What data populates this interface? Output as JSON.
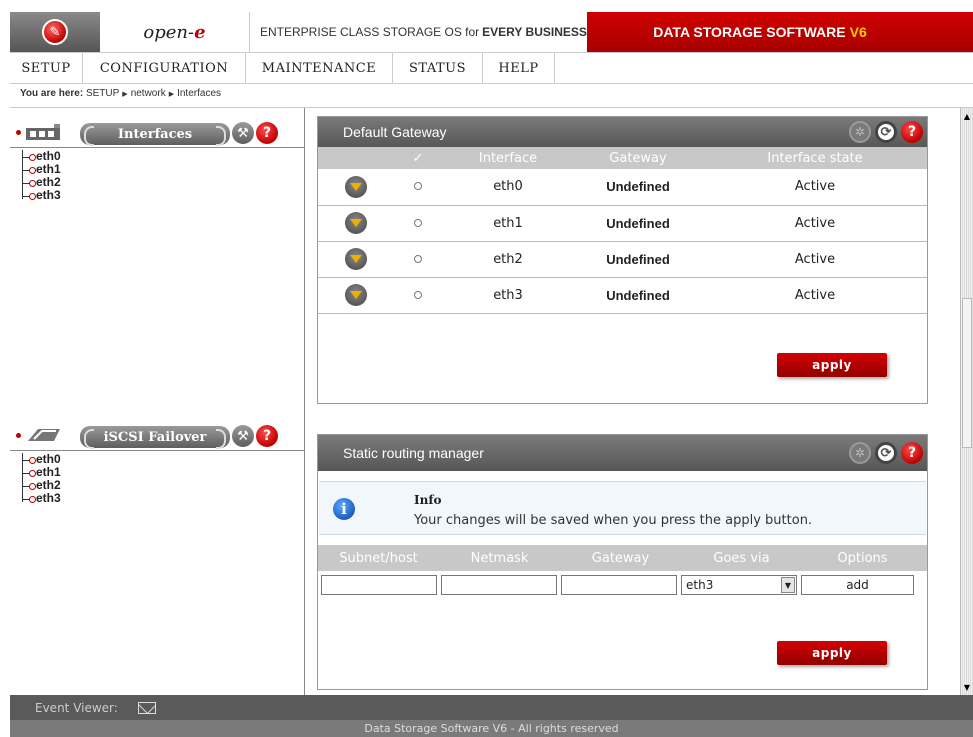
{
  "header": {
    "brand_prefix": "open-",
    "brand_suffix": "e",
    "slogan_prefix": "ENTERPRISE CLASS STORAGE OS for",
    "slogan_bold": "EVERY BUSINESS",
    "product_name": "DATA STORAGE SOFTWARE",
    "product_version": "V6",
    "brand_color": "#c00000",
    "version_color": "#ffcc00"
  },
  "menu": [
    "SETUP",
    "CONFIGURATION",
    "MAINTENANCE",
    "STATUS",
    "HELP"
  ],
  "breadcrumb": {
    "label": "You are here:",
    "items": [
      "SETUP",
      "network",
      "Interfaces"
    ]
  },
  "left": {
    "interfaces": {
      "title": "Interfaces",
      "items": [
        "eth0",
        "eth1",
        "eth2",
        "eth3"
      ]
    },
    "failover": {
      "title": "iSCSI Failover",
      "items": [
        "eth0",
        "eth1",
        "eth2",
        "eth3"
      ]
    }
  },
  "default_gateway": {
    "title": "Default Gateway",
    "columns": [
      "✓",
      "Interface",
      "Gateway",
      "Interface state"
    ],
    "rows": [
      {
        "interface": "eth0",
        "gateway": "Undefined",
        "state": "Active"
      },
      {
        "interface": "eth1",
        "gateway": "Undefined",
        "state": "Active"
      },
      {
        "interface": "eth2",
        "gateway": "Undefined",
        "state": "Active"
      },
      {
        "interface": "eth3",
        "gateway": "Undefined",
        "state": "Active"
      }
    ],
    "apply_label": "apply"
  },
  "static_routing": {
    "title": "Static routing manager",
    "info_title": "Info",
    "info_text": "Your changes will be saved when you press the apply button.",
    "columns": [
      "Subnet/host",
      "Netmask",
      "Gateway",
      "Goes via",
      "Options"
    ],
    "subnet_value": "",
    "netmask_value": "",
    "gateway_value": "",
    "goes_via": "eth3",
    "add_label": "add",
    "apply_label": "apply"
  },
  "footer": {
    "event_viewer": "Event Viewer:",
    "copyright": "Data Storage Software V6 - All rights reserved"
  }
}
